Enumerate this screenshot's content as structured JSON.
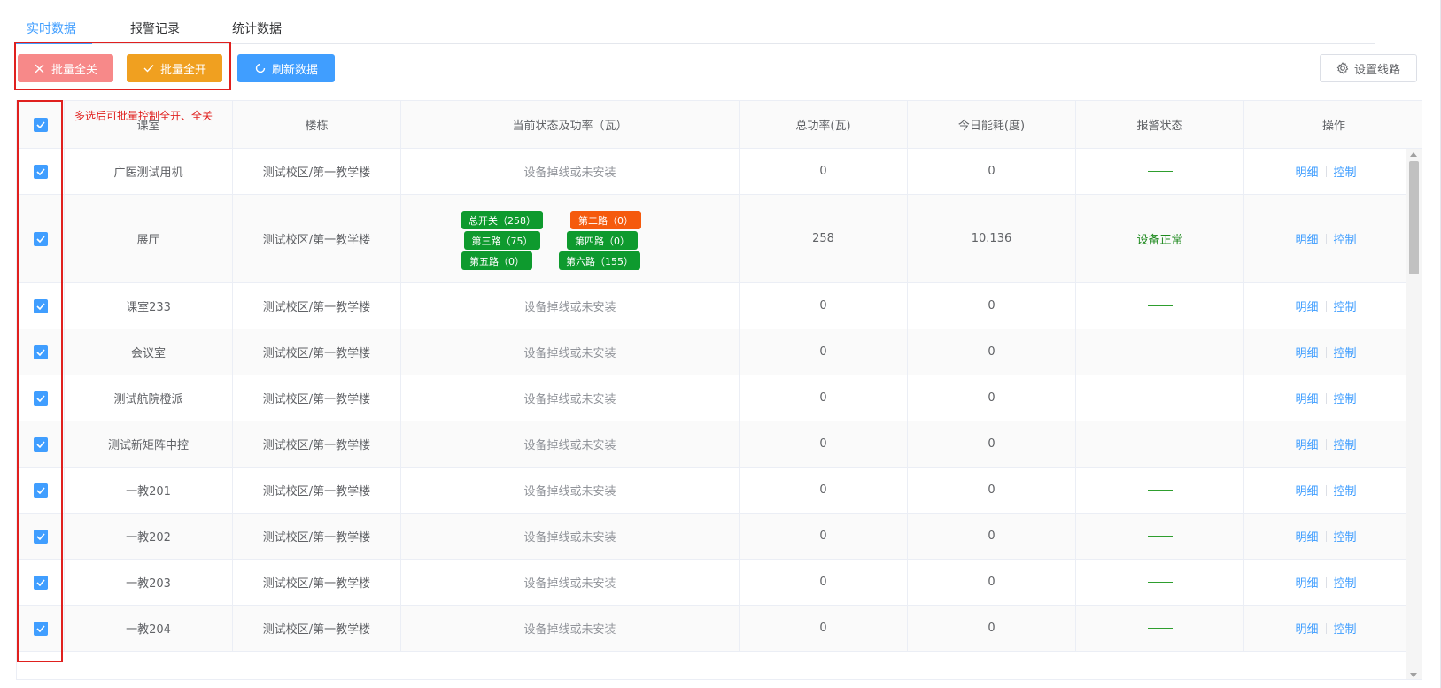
{
  "tabs": [
    {
      "label": "实时数据",
      "active": true
    },
    {
      "label": "报警记录",
      "active": false
    },
    {
      "label": "统计数据",
      "active": false
    }
  ],
  "toolbar": {
    "batch_close_label": "批量全关",
    "batch_open_label": "批量全开",
    "refresh_label": "刷新数据",
    "setting_label": "设置线路"
  },
  "annotation": "多选后可批量控制全开、全关",
  "table": {
    "headers": {
      "room": "课室",
      "building": "楼栋",
      "status": "当前状态及功率（瓦）",
      "total_power": "总功率(瓦)",
      "energy_today": "今日能耗(度)",
      "alarm": "报警状态",
      "action": "操作"
    },
    "action_detail": "明细",
    "action_control": "控制",
    "rows": [
      {
        "room": "广医测试用机",
        "building": "测试校区/第一教学楼",
        "status": "设备掉线或未安装",
        "total_power": "0",
        "energy_today": "0",
        "alarm": ""
      },
      {
        "room": "展厅",
        "building": "测试校区/第一教学楼",
        "status": "",
        "total_power": "258",
        "energy_today": "10.136",
        "alarm": "设备正常",
        "chips": [
          {
            "label": "总开关（258）",
            "color": "#0e9a2e"
          },
          {
            "label": "第二路（0）",
            "color": "#f55a0d"
          },
          {
            "label": "第三路（75）",
            "color": "#0e9a2e"
          },
          {
            "label": "第四路（0）",
            "color": "#0e9a2e"
          },
          {
            "label": "第五路（0）",
            "color": "#0e9a2e"
          },
          {
            "label": "第六路（155）",
            "color": "#0e9a2e"
          }
        ]
      },
      {
        "room": "课室233",
        "building": "测试校区/第一教学楼",
        "status": "设备掉线或未安装",
        "total_power": "0",
        "energy_today": "0",
        "alarm": ""
      },
      {
        "room": "会议室",
        "building": "测试校区/第一教学楼",
        "status": "设备掉线或未安装",
        "total_power": "0",
        "energy_today": "0",
        "alarm": ""
      },
      {
        "room": "测试航院橙派",
        "building": "测试校区/第一教学楼",
        "status": "设备掉线或未安装",
        "total_power": "0",
        "energy_today": "0",
        "alarm": ""
      },
      {
        "room": "测试新矩阵中控",
        "building": "测试校区/第一教学楼",
        "status": "设备掉线或未安装",
        "total_power": "0",
        "energy_today": "0",
        "alarm": ""
      },
      {
        "room": "一教201",
        "building": "测试校区/第一教学楼",
        "status": "设备掉线或未安装",
        "total_power": "0",
        "energy_today": "0",
        "alarm": ""
      },
      {
        "room": "一教202",
        "building": "测试校区/第一教学楼",
        "status": "设备掉线或未安装",
        "total_power": "0",
        "energy_today": "0",
        "alarm": ""
      },
      {
        "room": "一教203",
        "building": "测试校区/第一教学楼",
        "status": "设备掉线或未安装",
        "total_power": "0",
        "energy_today": "0",
        "alarm": ""
      },
      {
        "room": "一教204",
        "building": "测试校区/第一教学楼",
        "status": "设备掉线或未安装",
        "total_power": "0",
        "energy_today": "0",
        "alarm": ""
      }
    ]
  },
  "colors": {
    "accent": "#409eff",
    "danger_button": "#f78989",
    "warning_button": "#f0a020",
    "highlight_box": "#e0201e",
    "ok_green": "#0e9a2e",
    "chip_orange": "#f55a0d"
  }
}
